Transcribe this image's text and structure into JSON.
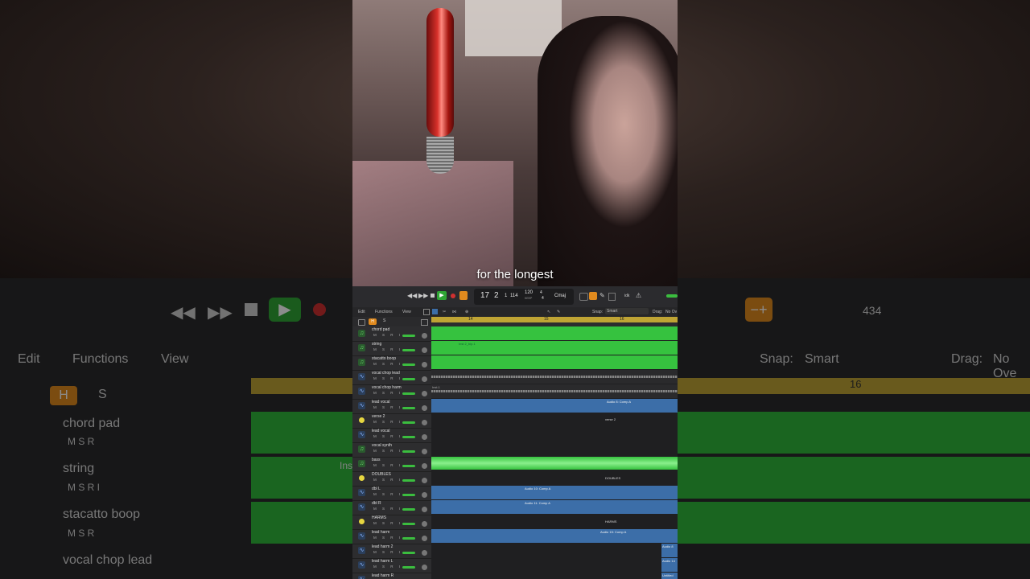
{
  "caption": "for the longest",
  "transport": {
    "bar": "17",
    "beat": "2",
    "division": "1",
    "tick": "114",
    "tempo": "120",
    "tempo_label": "KEEP",
    "signature_top": "4",
    "signature_bottom": "4",
    "key": "Cmaj",
    "cpu": "idk"
  },
  "menubar": {
    "edit": "Edit",
    "functions": "Functions",
    "view": "View",
    "snap_label": "Snap:",
    "snap_value": "Smart",
    "drag_label": "Drag:",
    "drag_value": "No Ov"
  },
  "trackhead": {
    "h": "H",
    "s": "S"
  },
  "ruler": {
    "marks": [
      "14",
      "15",
      "16"
    ]
  },
  "track_buttons": "M S R I",
  "tracks": [
    {
      "name": "chord pad",
      "type": "synth"
    },
    {
      "name": "string",
      "type": "synth"
    },
    {
      "name": "stacatto boop",
      "type": "synth"
    },
    {
      "name": "vocal chop lead",
      "type": "audio"
    },
    {
      "name": "vocal chop harm",
      "type": "audio"
    },
    {
      "name": "lead vocal",
      "type": "audio"
    },
    {
      "name": "verse 2",
      "type": "folder"
    },
    {
      "name": "lead vocal",
      "type": "audio"
    },
    {
      "name": "vocal synth",
      "type": "synth"
    },
    {
      "name": "bass",
      "type": "synth"
    },
    {
      "name": "DOUBLES",
      "type": "folder"
    },
    {
      "name": "dbl L",
      "type": "audio"
    },
    {
      "name": "dbl R",
      "type": "audio"
    },
    {
      "name": "HARMS",
      "type": "folder"
    },
    {
      "name": "lead harm",
      "type": "audio"
    },
    {
      "name": "lead harm 2",
      "type": "audio"
    },
    {
      "name": "lead harm L",
      "type": "audio"
    },
    {
      "name": "lead harm R",
      "type": "audio"
    }
  ],
  "regions": {
    "string_label": "Inst 2_bip.1",
    "vocal_chop_label": "Inst.1",
    "lead_vocal_label": "Audio 8: Comp A",
    "verse2_marker": "verse 2",
    "doubles_marker": "DOUBLES",
    "dblL_label": "Audio 10: Comp A",
    "dblR_label": "Audio 11: Comp A",
    "harms_marker": "HARMS",
    "lead_harm_label": "Audio 15: Comp A",
    "small_1": "Audio 8",
    "small_2": "Audio 14",
    "small_3": "Untitled"
  },
  "background": {
    "edit": "Edit",
    "functions": "Functions",
    "view": "View",
    "snap_label": "Snap:",
    "snap_value": "Smart",
    "drag_label": "Drag:",
    "drag_value": "No Ove",
    "ruler_mark": "16",
    "h": "H",
    "s": "S",
    "tracks": [
      "chord pad",
      "string",
      "stacatto boop",
      "vocal chop lead"
    ],
    "buttons": "M  S  R",
    "buttons_i": "M  S  R  I",
    "counter": "434",
    "lane_label": "Ins"
  },
  "colors": {
    "region_green": "#36c23f",
    "region_blue": "#3c6ea8",
    "ruler_yellow": "#bfa434",
    "play_green": "#2fa534",
    "record_red": "#d03030",
    "cycle_orange": "#e08a1e"
  }
}
